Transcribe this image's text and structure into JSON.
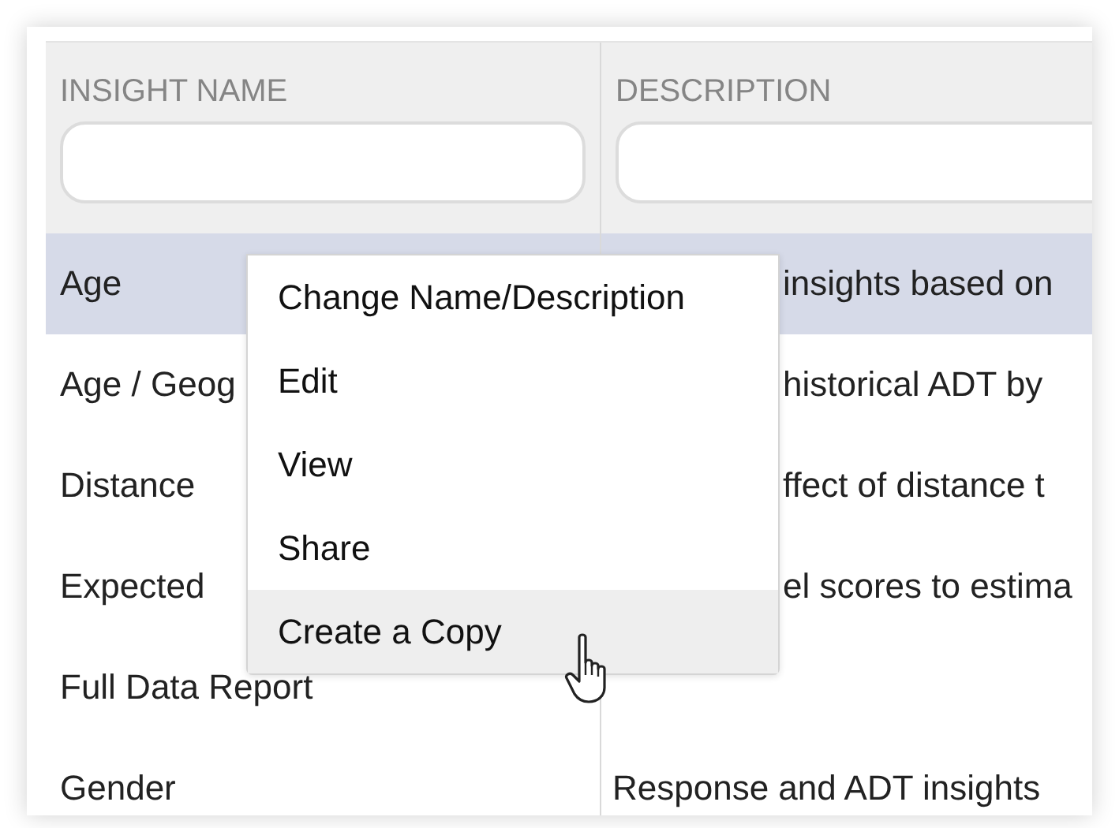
{
  "table": {
    "columns": [
      {
        "header": "INSIGHT NAME"
      },
      {
        "header": "DESCRIPTION"
      }
    ],
    "rows": [
      {
        "name": "Age",
        "description": "insights based on",
        "selected": true
      },
      {
        "name": "Age / Geog",
        "description": "historical ADT by",
        "selected": false
      },
      {
        "name": "Distance",
        "description": "ffect of distance t",
        "selected": false
      },
      {
        "name": "Expected",
        "description": "el scores to estima",
        "selected": false
      },
      {
        "name": "Full Data Report",
        "description": "",
        "selected": false
      },
      {
        "name": "Gender",
        "description": "Response and ADT insights",
        "selected": false
      }
    ]
  },
  "context_menu": {
    "items": [
      {
        "label": "Change Name/Description",
        "hovered": false
      },
      {
        "label": "Edit",
        "hovered": false
      },
      {
        "label": "View",
        "hovered": false
      },
      {
        "label": "Share",
        "hovered": false
      },
      {
        "label": "Create a Copy",
        "hovered": true
      }
    ]
  }
}
